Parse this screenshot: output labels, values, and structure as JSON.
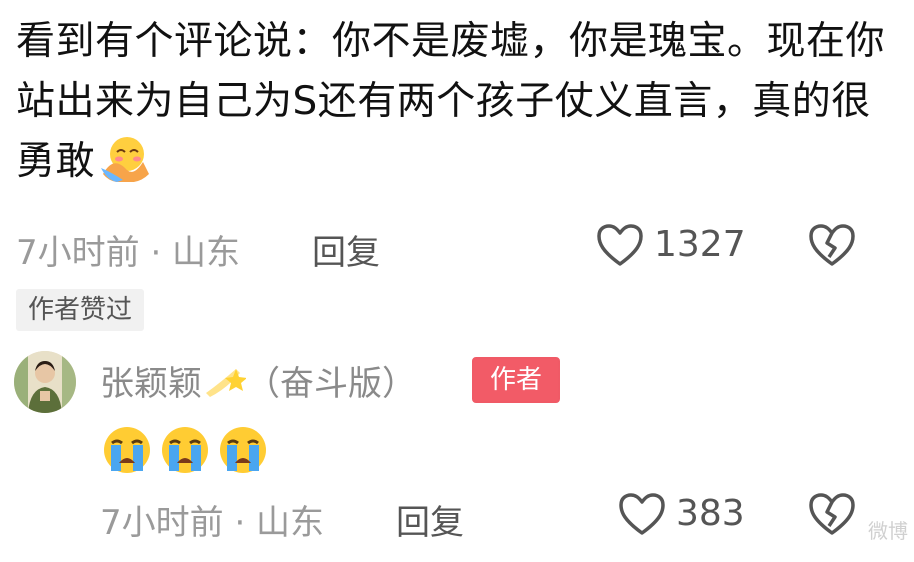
{
  "comment": {
    "text": "看到有个评论说：你不是废墟，你是瑰宝。现在你站出来为自己为S还有两个孩子仗义直言，真的很勇敢",
    "emoji": "hug-face-emoji",
    "time_location": "7小时前 · 山东",
    "reply_label": "回复",
    "like_count": "1327",
    "liked_by_author_badge": "作者赞过"
  },
  "author_reply": {
    "username": "张颖颖",
    "username_suffix": "（奋斗版）",
    "author_tag": "作者",
    "emojis": [
      "crying-face-emoji",
      "crying-face-emoji",
      "crying-face-emoji"
    ],
    "time_location": "7小时前 · 山东",
    "reply_label": "回复",
    "like_count": "383"
  },
  "watermark": "微博",
  "colors": {
    "author_tag": "#f25b67",
    "meta_gray": "#9a9a9a",
    "icon_gray": "#555555"
  }
}
